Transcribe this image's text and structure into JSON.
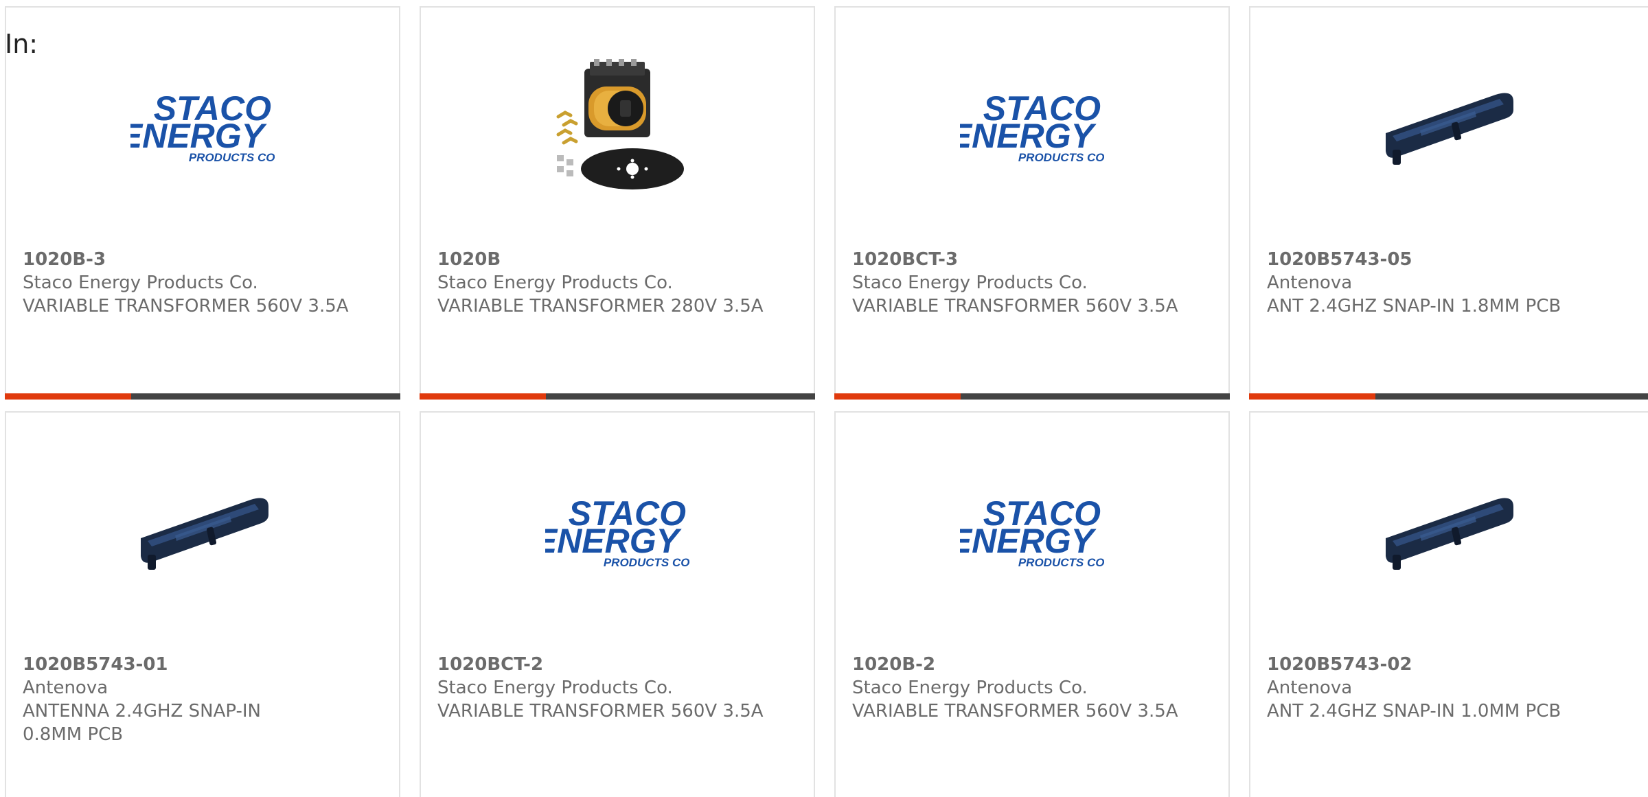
{
  "header": {
    "in_label": "In:"
  },
  "colors": {
    "accent": "#e03a0d",
    "bar": "#444444",
    "text": "#6b6b6b",
    "logo_blue": "#1a52a8",
    "border": "#e2e2e2"
  },
  "products": [
    {
      "part_number": "1020B-3",
      "manufacturer": "Staco Energy Products Co.",
      "description": "VARIABLE TRANSFORMER 560V 3.5A",
      "image_icon": "staco-logo-icon"
    },
    {
      "part_number": "1020B",
      "manufacturer": "Staco Energy Products Co.",
      "description": "VARIABLE TRANSFORMER 280V 3.5A",
      "image_icon": "variable-transformer-icon"
    },
    {
      "part_number": "1020BCT-3",
      "manufacturer": "Staco Energy Products Co.",
      "description": "VARIABLE TRANSFORMER 560V 3.5A",
      "image_icon": "staco-logo-icon"
    },
    {
      "part_number": "1020B5743-05",
      "manufacturer": "Antenova",
      "description": "ANT 2.4GHZ SNAP-IN 1.8MM PCB",
      "image_icon": "snap-in-antenna-icon"
    },
    {
      "part_number": "1020B5743-01",
      "manufacturer": "Antenova",
      "description": "ANTENNA 2.4GHZ SNAP-IN 0.8MM PCB",
      "image_icon": "snap-in-antenna-icon"
    },
    {
      "part_number": "1020BCT-2",
      "manufacturer": "Staco Energy Products Co.",
      "description": "VARIABLE TRANSFORMER 560V 3.5A",
      "image_icon": "staco-logo-icon"
    },
    {
      "part_number": "1020B-2",
      "manufacturer": "Staco Energy Products Co.",
      "description": "VARIABLE TRANSFORMER 560V 3.5A",
      "image_icon": "staco-logo-icon"
    },
    {
      "part_number": "1020B5743-02",
      "manufacturer": "Antenova",
      "description": "ANT 2.4GHZ SNAP-IN 1.0MM PCB",
      "image_icon": "snap-in-antenna-icon"
    }
  ],
  "logo": {
    "line1": "STACO",
    "line2": "ENERGY",
    "line3": "PRODUCTS CO."
  }
}
